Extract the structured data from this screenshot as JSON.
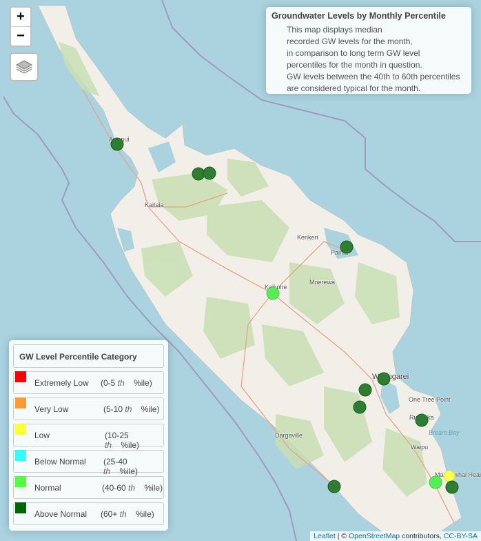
{
  "map": {
    "places": [
      "Awanui",
      "Kaitaia",
      "Kerikeri",
      "Paihia",
      "Moerewa",
      "Kaikohe",
      "Whangarei",
      "One Tree Point",
      "Ruakaka",
      "Bream Bay",
      "Waipu",
      "Dargaville",
      "Mangawhai Heads"
    ],
    "zoom_in": "+",
    "zoom_out": "−",
    "layers_icon": "layers-icon"
  },
  "info": {
    "title": "Groundwater Levels by Monthly Percentile",
    "lines": [
      "This map displays median",
      "recorded GW levels for the month,",
      "in comparison to long term GW level",
      "percentiles for the month in question.",
      "GW levels between the 40th to 60th percentiles",
      "are considered typical for the month."
    ]
  },
  "legend": {
    "title": "GW Level Percentile Category",
    "items": [
      {
        "label": "Extremely Low",
        "range_a": "(0-5",
        "th": "th",
        "range_b": "%ile)",
        "color": "#ff0000"
      },
      {
        "label": "Very Low",
        "range_a": "(5-10",
        "th": "th",
        "range_b": "%ile)",
        "color": "#ff9933"
      },
      {
        "label": "Low",
        "range_a": "(10-25",
        "th": "th",
        "range_b": "%ile)",
        "color": "#ffff33"
      },
      {
        "label": "Below Normal",
        "range_a": "(25-40",
        "th": "th",
        "range_b": "%ile)",
        "color": "#33ffff"
      },
      {
        "label": "Normal",
        "range_a": "(40-60",
        "th": "th",
        "range_b": "%ile)",
        "color": "#55ff44"
      },
      {
        "label": "Above Normal",
        "range_a": "(60+",
        "th": "th",
        "range_b": "%ile)",
        "color": "#006600"
      }
    ]
  },
  "sites": [
    {
      "category": "Above Normal"
    },
    {
      "category": "Above Normal"
    },
    {
      "category": "Above Normal"
    },
    {
      "category": "Above Normal"
    },
    {
      "category": "Normal"
    },
    {
      "category": "Above Normal"
    },
    {
      "category": "Above Normal"
    },
    {
      "category": "Above Normal"
    },
    {
      "category": "Above Normal"
    },
    {
      "category": "Above Normal"
    },
    {
      "category": "Low"
    },
    {
      "category": "Normal"
    },
    {
      "category": "Above Normal"
    }
  ],
  "attribution": {
    "leaflet": "Leaflet",
    "sep": " | © ",
    "osm": "OpenStreetMap",
    "contrib": " contributors, ",
    "license": "CC-BY-SA"
  }
}
